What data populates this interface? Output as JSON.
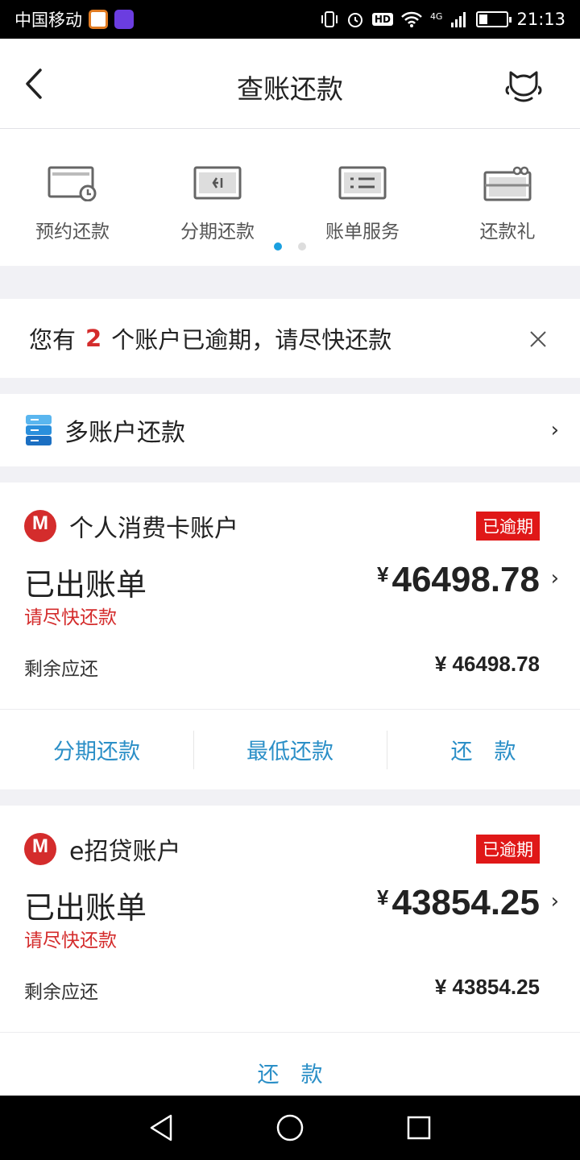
{
  "status_bar": {
    "carrier": "中国移动",
    "network": "4G",
    "time": "21:13",
    "hd": "HD"
  },
  "header": {
    "title": "查账还款"
  },
  "quick_entries": [
    {
      "label": "预约还款",
      "icon": "card-clock-icon"
    },
    {
      "label": "分期还款",
      "icon": "card-installment-icon"
    },
    {
      "label": "账单服务",
      "icon": "bill-list-icon"
    },
    {
      "label": "还款礼",
      "icon": "gift-icon"
    }
  ],
  "notice": {
    "prefix": "您有",
    "count": "2",
    "suffix": "个账户已逾期，请尽快还款"
  },
  "multi_account": {
    "label": "多账户还款"
  },
  "accounts": [
    {
      "name": "个人消费卡账户",
      "badge": "已逾期",
      "bill_label": "已出账单",
      "urge": "请尽快还款",
      "currency": "¥",
      "amount": "46498.78",
      "remain_label": "剩余应还",
      "remain_value": "¥ 46498.78",
      "actions": [
        "分期还款",
        "最低还款",
        "还　款"
      ]
    },
    {
      "name": "e招贷账户",
      "badge": "已逾期",
      "bill_label": "已出账单",
      "urge": "请尽快还款",
      "currency": "¥",
      "amount": "43854.25",
      "remain_label": "剩余应还",
      "remain_value": "¥ 43854.25",
      "actions": [
        "还　款"
      ]
    }
  ],
  "colors": {
    "accent_blue": "#2b8fc7",
    "alert_red": "#d42c2c",
    "badge_red": "#e01818"
  }
}
